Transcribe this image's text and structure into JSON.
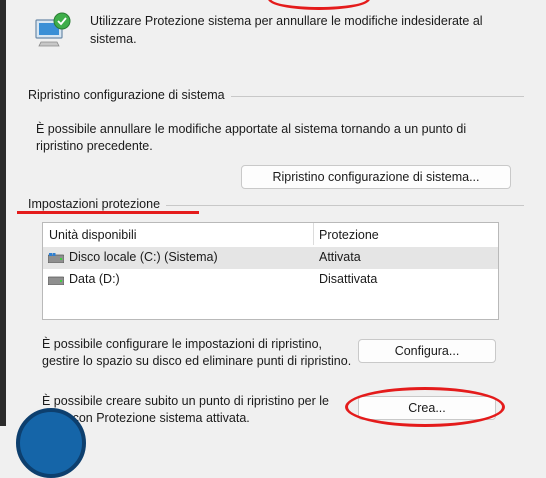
{
  "header": {
    "description": "Utilizzare Protezione sistema per annullare le modifiche indesiderate al sistema.",
    "icon": "system-protection-computer-icon"
  },
  "restore_group": {
    "title": "Ripristino configurazione di sistema",
    "description": "È possibile annullare le modifiche apportate al sistema tornando a un punto di ripristino precedente.",
    "button_label": "Ripristino configurazione di sistema..."
  },
  "protection_group": {
    "title": "Impostazioni protezione",
    "columns": [
      "Unità disponibili",
      "Protezione"
    ],
    "drives": [
      {
        "name": "Disco locale (C:) (Sistema)",
        "status": "Attivata",
        "icon": "system-drive-icon",
        "selected": true
      },
      {
        "name": "Data (D:)",
        "status": "Disattivata",
        "icon": "drive-icon",
        "selected": false
      }
    ],
    "configure_text": "È possibile configurare le impostazioni di ripristino, gestire lo spazio su disco ed eliminare punti di ripristino.",
    "configure_button": "Configura...",
    "create_text": "È possibile creare subito un punto di ripristino per le unità con Protezione sistema attivata.",
    "create_button": "Crea..."
  },
  "colors": {
    "annotation": "#e41b1b",
    "dialog_background": "#f0f0f0",
    "selected_row": "#e5e5e5"
  }
}
